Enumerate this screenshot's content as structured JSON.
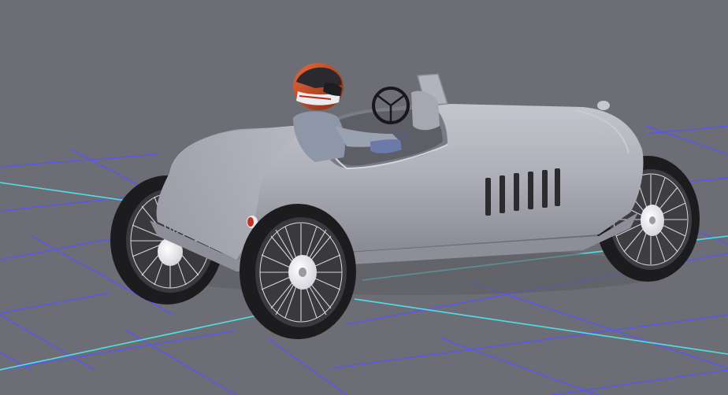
{
  "viewport": {
    "background_color": "#6d6e75",
    "grid_color": "#5a56f0",
    "axis_color": "#4fe0e6"
  },
  "model": {
    "body_color": "#a9aab4",
    "tire_color": "#1c1c1e",
    "spoke_color": "#e4e4ea",
    "helmet_color": "#d8502a",
    "suit_color": "#8e97a8"
  }
}
